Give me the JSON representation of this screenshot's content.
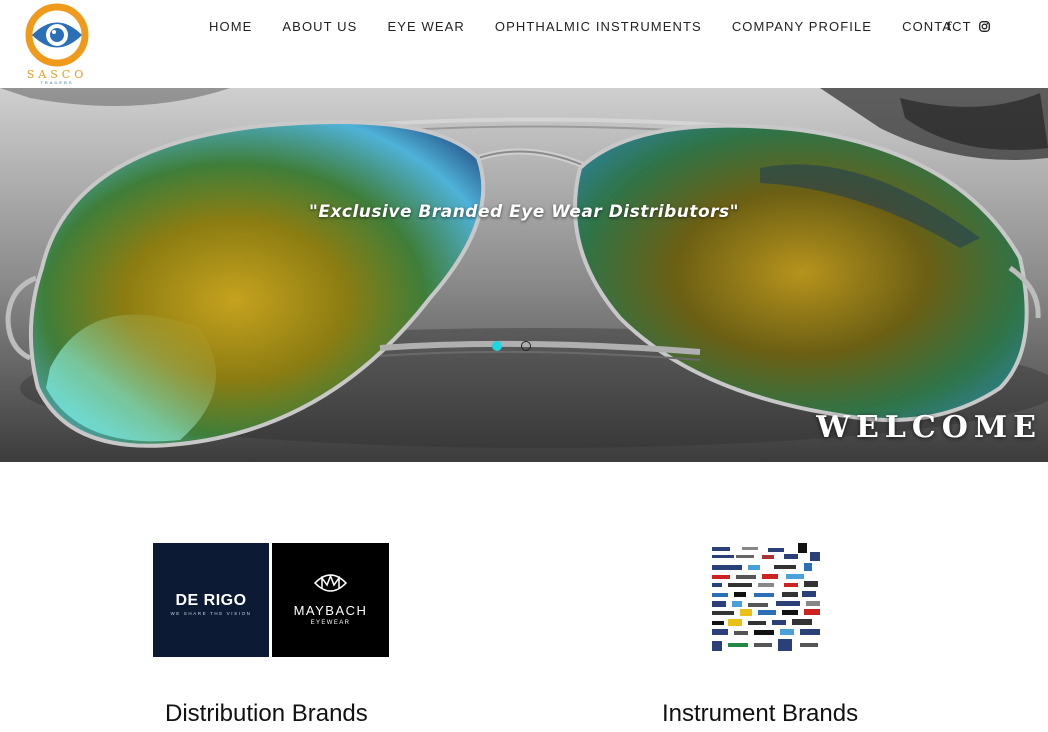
{
  "logo": {
    "name": "SASCO",
    "subtitle": "TRADERS"
  },
  "nav": {
    "items": [
      {
        "label": "HOME"
      },
      {
        "label": "ABOUT US"
      },
      {
        "label": "EYE WEAR"
      },
      {
        "label": "OPHTHALMIC INSTRUMENTS"
      },
      {
        "label": "COMPANY PROFILE"
      },
      {
        "label": "CONTACT"
      }
    ],
    "social": [
      {
        "icon": "facebook-icon",
        "glyph": "f"
      },
      {
        "icon": "instagram-icon"
      }
    ]
  },
  "hero": {
    "tagline": "\"Exclusive Branded Eye Wear Distributors\"",
    "welcome": "WELCOME",
    "slides_total": 2,
    "active_slide": 1,
    "accent_color": "#1fd6e0"
  },
  "brands": {
    "distribution": {
      "label": "Distribution Brands",
      "logos": [
        {
          "name": "DE RIGO",
          "tagline": "WE SHARE THE VISION"
        },
        {
          "name": "MAYBACH",
          "tagline": "EYEWEAR"
        }
      ]
    },
    "instrument": {
      "label": "Instrument Brands"
    }
  },
  "colors": {
    "logo_orange": "#f09a1c",
    "logo_blue": "#2b6fb6",
    "derigo_bg": "#0d1a33"
  }
}
